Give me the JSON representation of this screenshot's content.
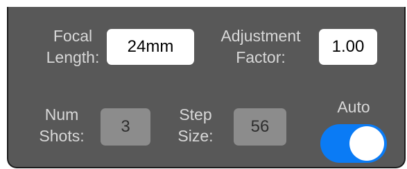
{
  "settings": {
    "focal_length": {
      "label_line1": "Focal",
      "label_line2": "Length:",
      "value": "24mm"
    },
    "adjustment_factor": {
      "label_line1": "Adjustment",
      "label_line2": "Factor:",
      "value": "1.00"
    },
    "num_shots": {
      "label_line1": "Num",
      "label_line2": "Shots:",
      "value": "3"
    },
    "step_size": {
      "label_line1": "Step",
      "label_line2": "Size:",
      "value": "56"
    },
    "auto": {
      "label": "Auto",
      "enabled": true
    }
  },
  "colors": {
    "panel": "#585858",
    "label": "#d8d8d8",
    "toggle_on": "#0a7bf5",
    "readonly_field": "#8c8c8c"
  }
}
